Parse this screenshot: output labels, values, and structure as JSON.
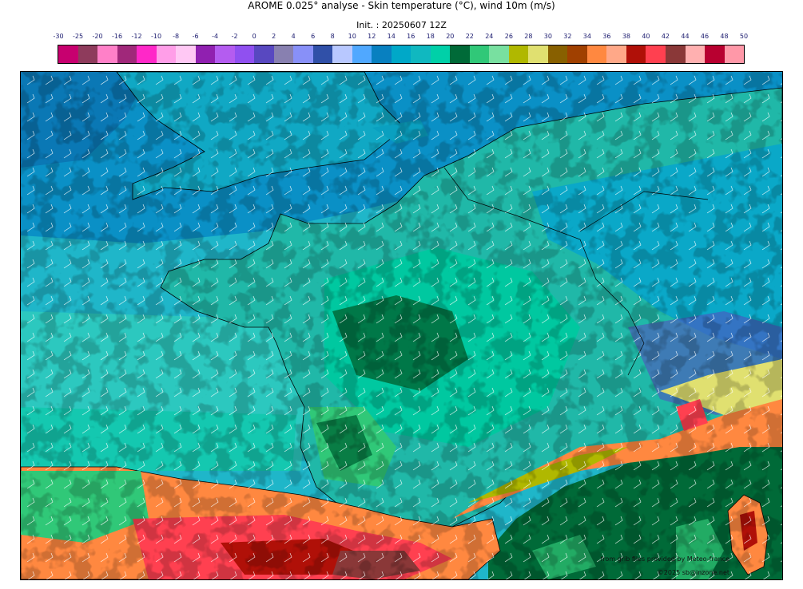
{
  "title": "AROME 0.025° analyse - Skin temperature (°C), wind 10m (m/s)",
  "subtitle": "Init. : 20250607 12Z",
  "colorbar": {
    "labels": [
      "-30",
      "-25",
      "-20",
      "-16",
      "-12",
      "-10",
      "-8",
      "-6",
      "-4",
      "-2",
      "0",
      "2",
      "4",
      "6",
      "8",
      "10",
      "12",
      "14",
      "16",
      "18",
      "20",
      "22",
      "24",
      "26",
      "28",
      "30",
      "32",
      "34",
      "36",
      "38",
      "40",
      "42",
      "44",
      "46",
      "48",
      "50"
    ],
    "colors": [
      "#c7006f",
      "#8e3b5c",
      "#ff80c8",
      "#a0287a",
      "#ff28c8",
      "#ff9ee8",
      "#ffc8f4",
      "#9020b0",
      "#b45cf0",
      "#9050f0",
      "#5848c0",
      "#8880b0",
      "#8890f8",
      "#3050a8",
      "#b8c8ff",
      "#50a8ff",
      "#0880c0",
      "#00a8c8",
      "#10b8c0",
      "#00d0a8",
      "#006a38",
      "#30c878",
      "#78e0a0",
      "#b0b800",
      "#e0e070",
      "#886000",
      "#a04000",
      "#ff8840",
      "#ffa888",
      "#b01008",
      "#ff4050",
      "#8a3838",
      "#ffb0b0",
      "#b80030",
      "#ff98a8"
    ]
  },
  "credits": {
    "source": "from grib files provided by Meteo-france",
    "copyright": "©2025 sb@inzone.net"
  }
}
